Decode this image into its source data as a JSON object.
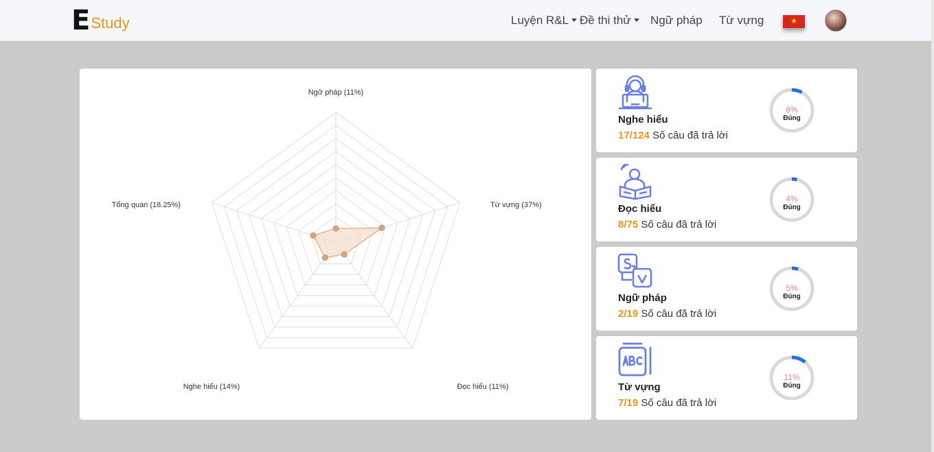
{
  "brand": {
    "letter": "E",
    "name": "Study",
    "accent": "#e8941c"
  },
  "nav": {
    "items": [
      {
        "label": "Luyện R&L",
        "dropdown": true
      },
      {
        "label": "Đề thi thử",
        "dropdown": true
      },
      {
        "label": "Ngữ pháp",
        "dropdown": false
      },
      {
        "label": "Từ vựng",
        "dropdown": false
      }
    ],
    "language_flag": "vietnam-flag-icon",
    "flag_star": "★"
  },
  "radar": {
    "labels": [
      "Ngữ pháp (11%)",
      "Từ vựng (37%)",
      "Đọc hiểu (11%)",
      "Nghe hiểu (14%)",
      "Tổng quan (18.25%)"
    ],
    "values": [
      11,
      37,
      11,
      14,
      18.25
    ],
    "max": 100,
    "grid_levels": 10,
    "fill": "#f4dfcf",
    "stroke": "#e3b48e",
    "point": "#d9a57d"
  },
  "stats": [
    {
      "icon": "headset-laptop-icon",
      "title": "Nghe hiểu",
      "count": "17/124",
      "caption": "Số câu đã trả lời",
      "percent": 8,
      "percent_label": "8%",
      "ring_label": "Đúng"
    },
    {
      "icon": "reader-book-icon",
      "title": "Đọc hiểu",
      "count": "8/75",
      "caption": "Số câu đã trả lời",
      "percent": 4,
      "percent_label": "4%",
      "ring_label": "Đúng"
    },
    {
      "icon": "grammar-sv-icon",
      "title": "Ngữ pháp",
      "count": "2/19",
      "caption": "Số câu đã trả lời",
      "percent": 5,
      "percent_label": "5%",
      "ring_label": "Đúng"
    },
    {
      "icon": "abc-notebook-icon",
      "title": "Từ vựng",
      "count": "7/19",
      "caption": "Số câu đã trả lời",
      "percent": 11,
      "percent_label": "11%",
      "ring_label": "Đúng"
    }
  ],
  "colors": {
    "icon": "#6b7fe3",
    "ring_track": "#d9d9d9",
    "ring_progress": "#1a73e8"
  }
}
